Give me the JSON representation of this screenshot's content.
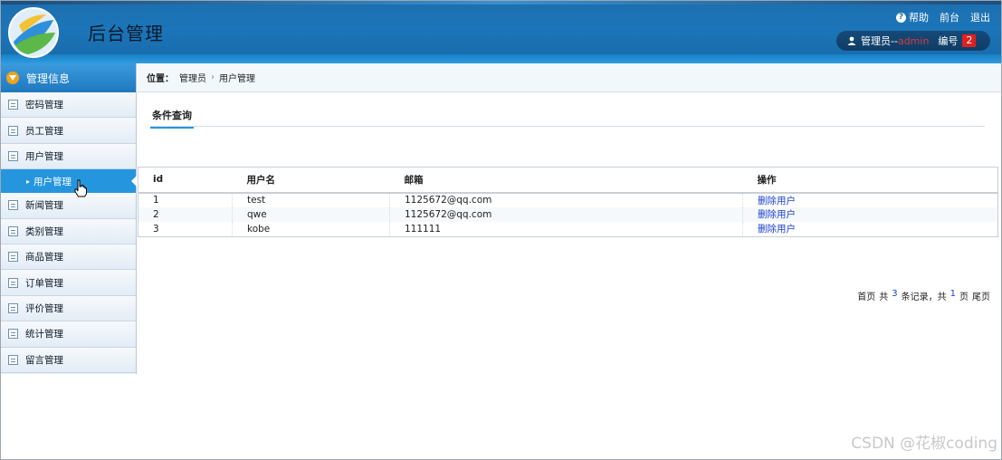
{
  "header": {
    "title": "后台管理",
    "links": {
      "help": "帮助",
      "front": "前台",
      "logout": "退出"
    },
    "user": {
      "prefix": "管理员--",
      "name": "admin",
      "number_label": "编号",
      "number": "2"
    },
    "colors": {
      "accent": "#1c75b9",
      "badge": "#e02020",
      "admin": "#d63b3b"
    }
  },
  "sidebar": {
    "header": "管理信息",
    "items_before": [
      {
        "label": "密码管理",
        "icon": "list-icon"
      },
      {
        "label": "员工管理",
        "icon": "list-icon"
      },
      {
        "label": "用户管理",
        "icon": "list-icon"
      }
    ],
    "sub_item": "用户管理",
    "items_after": [
      {
        "label": "新闻管理",
        "icon": "list-icon"
      },
      {
        "label": "类别管理",
        "icon": "list-icon"
      },
      {
        "label": "商品管理",
        "icon": "list-icon"
      },
      {
        "label": "订单管理",
        "icon": "list-icon"
      },
      {
        "label": "评价管理",
        "icon": "list-icon"
      },
      {
        "label": "统计管理",
        "icon": "list-icon"
      },
      {
        "label": "留言管理",
        "icon": "list-icon"
      }
    ]
  },
  "breadcrumb": {
    "label": "位置：",
    "path": [
      "管理员",
      "用户管理"
    ]
  },
  "tab": {
    "label": "条件查询"
  },
  "table": {
    "columns": [
      "id",
      "用户名",
      "邮箱",
      "操作"
    ],
    "rows": [
      {
        "id": "1",
        "username": "test",
        "email": "1125672@qq.com",
        "action": "删除用户"
      },
      {
        "id": "2",
        "username": "qwe",
        "email": "1125672@qq.com",
        "action": "删除用户"
      },
      {
        "id": "3",
        "username": "kobe",
        "email": "111111",
        "action": "删除用户"
      }
    ]
  },
  "pager": {
    "first": "首页",
    "total_prefix": "共",
    "total": "3",
    "records_suffix": "条记录，共",
    "pages": "1",
    "pages_suffix": "页",
    "last": "尾页"
  },
  "watermark": "CSDN @花椒coding"
}
